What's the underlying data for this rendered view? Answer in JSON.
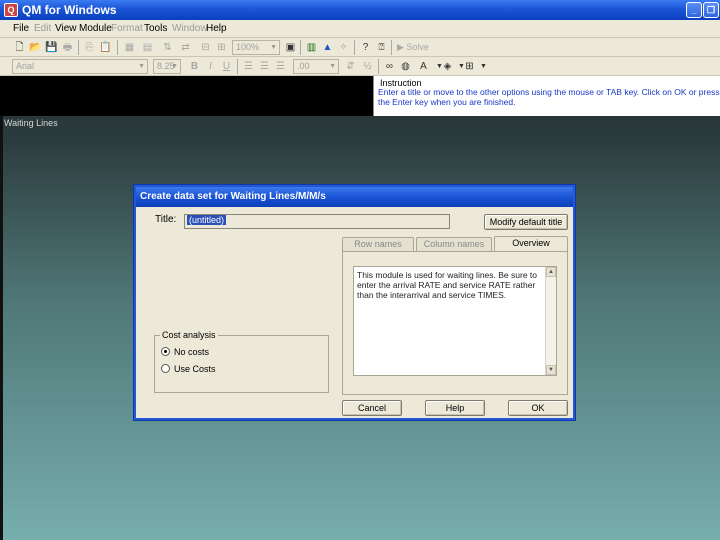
{
  "app": {
    "title": "QM for Windows",
    "icon": "app-logo-icon"
  },
  "window_buttons": [
    "minimize-icon",
    "restore-icon"
  ],
  "menu": [
    {
      "label": "File",
      "enabled": true
    },
    {
      "label": "Edit",
      "enabled": false
    },
    {
      "label": "View",
      "enabled": true
    },
    {
      "label": "Module",
      "enabled": true
    },
    {
      "label": "Format",
      "enabled": false
    },
    {
      "label": "Tools",
      "enabled": true
    },
    {
      "label": "Window",
      "enabled": false
    },
    {
      "label": "Help",
      "enabled": true
    }
  ],
  "toolbar1": {
    "zoom": "100%",
    "solve_label": "Solve"
  },
  "toolbar2": {
    "font": "Arial",
    "font_size": "8.25",
    "decimals": ".00"
  },
  "instruction": {
    "title": "Instruction",
    "text": "Enter a title or move to the other options using the mouse or TAB key. Click on OK or press the Enter key when you are finished."
  },
  "workspace_label": "Waiting Lines",
  "dialog": {
    "title": "Create data set for Waiting Lines/M/M/s",
    "title_label": "Title:",
    "title_value": "(untitled)",
    "modify_button": "Modify default title",
    "tabs": [
      {
        "label": "Row names",
        "active": false
      },
      {
        "label": "Column names",
        "active": false
      },
      {
        "label": "Overview",
        "active": true
      }
    ],
    "overview_text": "This module is used for waiting lines. Be sure to enter the arrival RATE and service RATE rather than the interarrival and service TIMES.",
    "cost_group": {
      "label": "Cost analysis",
      "options": [
        {
          "label": "No costs",
          "checked": true
        },
        {
          "label": "Use Costs",
          "checked": false
        }
      ]
    },
    "buttons": {
      "cancel": "Cancel",
      "help": "Help",
      "ok": "OK"
    }
  },
  "colors": {
    "titlebar_blue": "#1b55d6",
    "instruction_text": "#1a38c8",
    "dialog_face": "#ece9d8"
  }
}
